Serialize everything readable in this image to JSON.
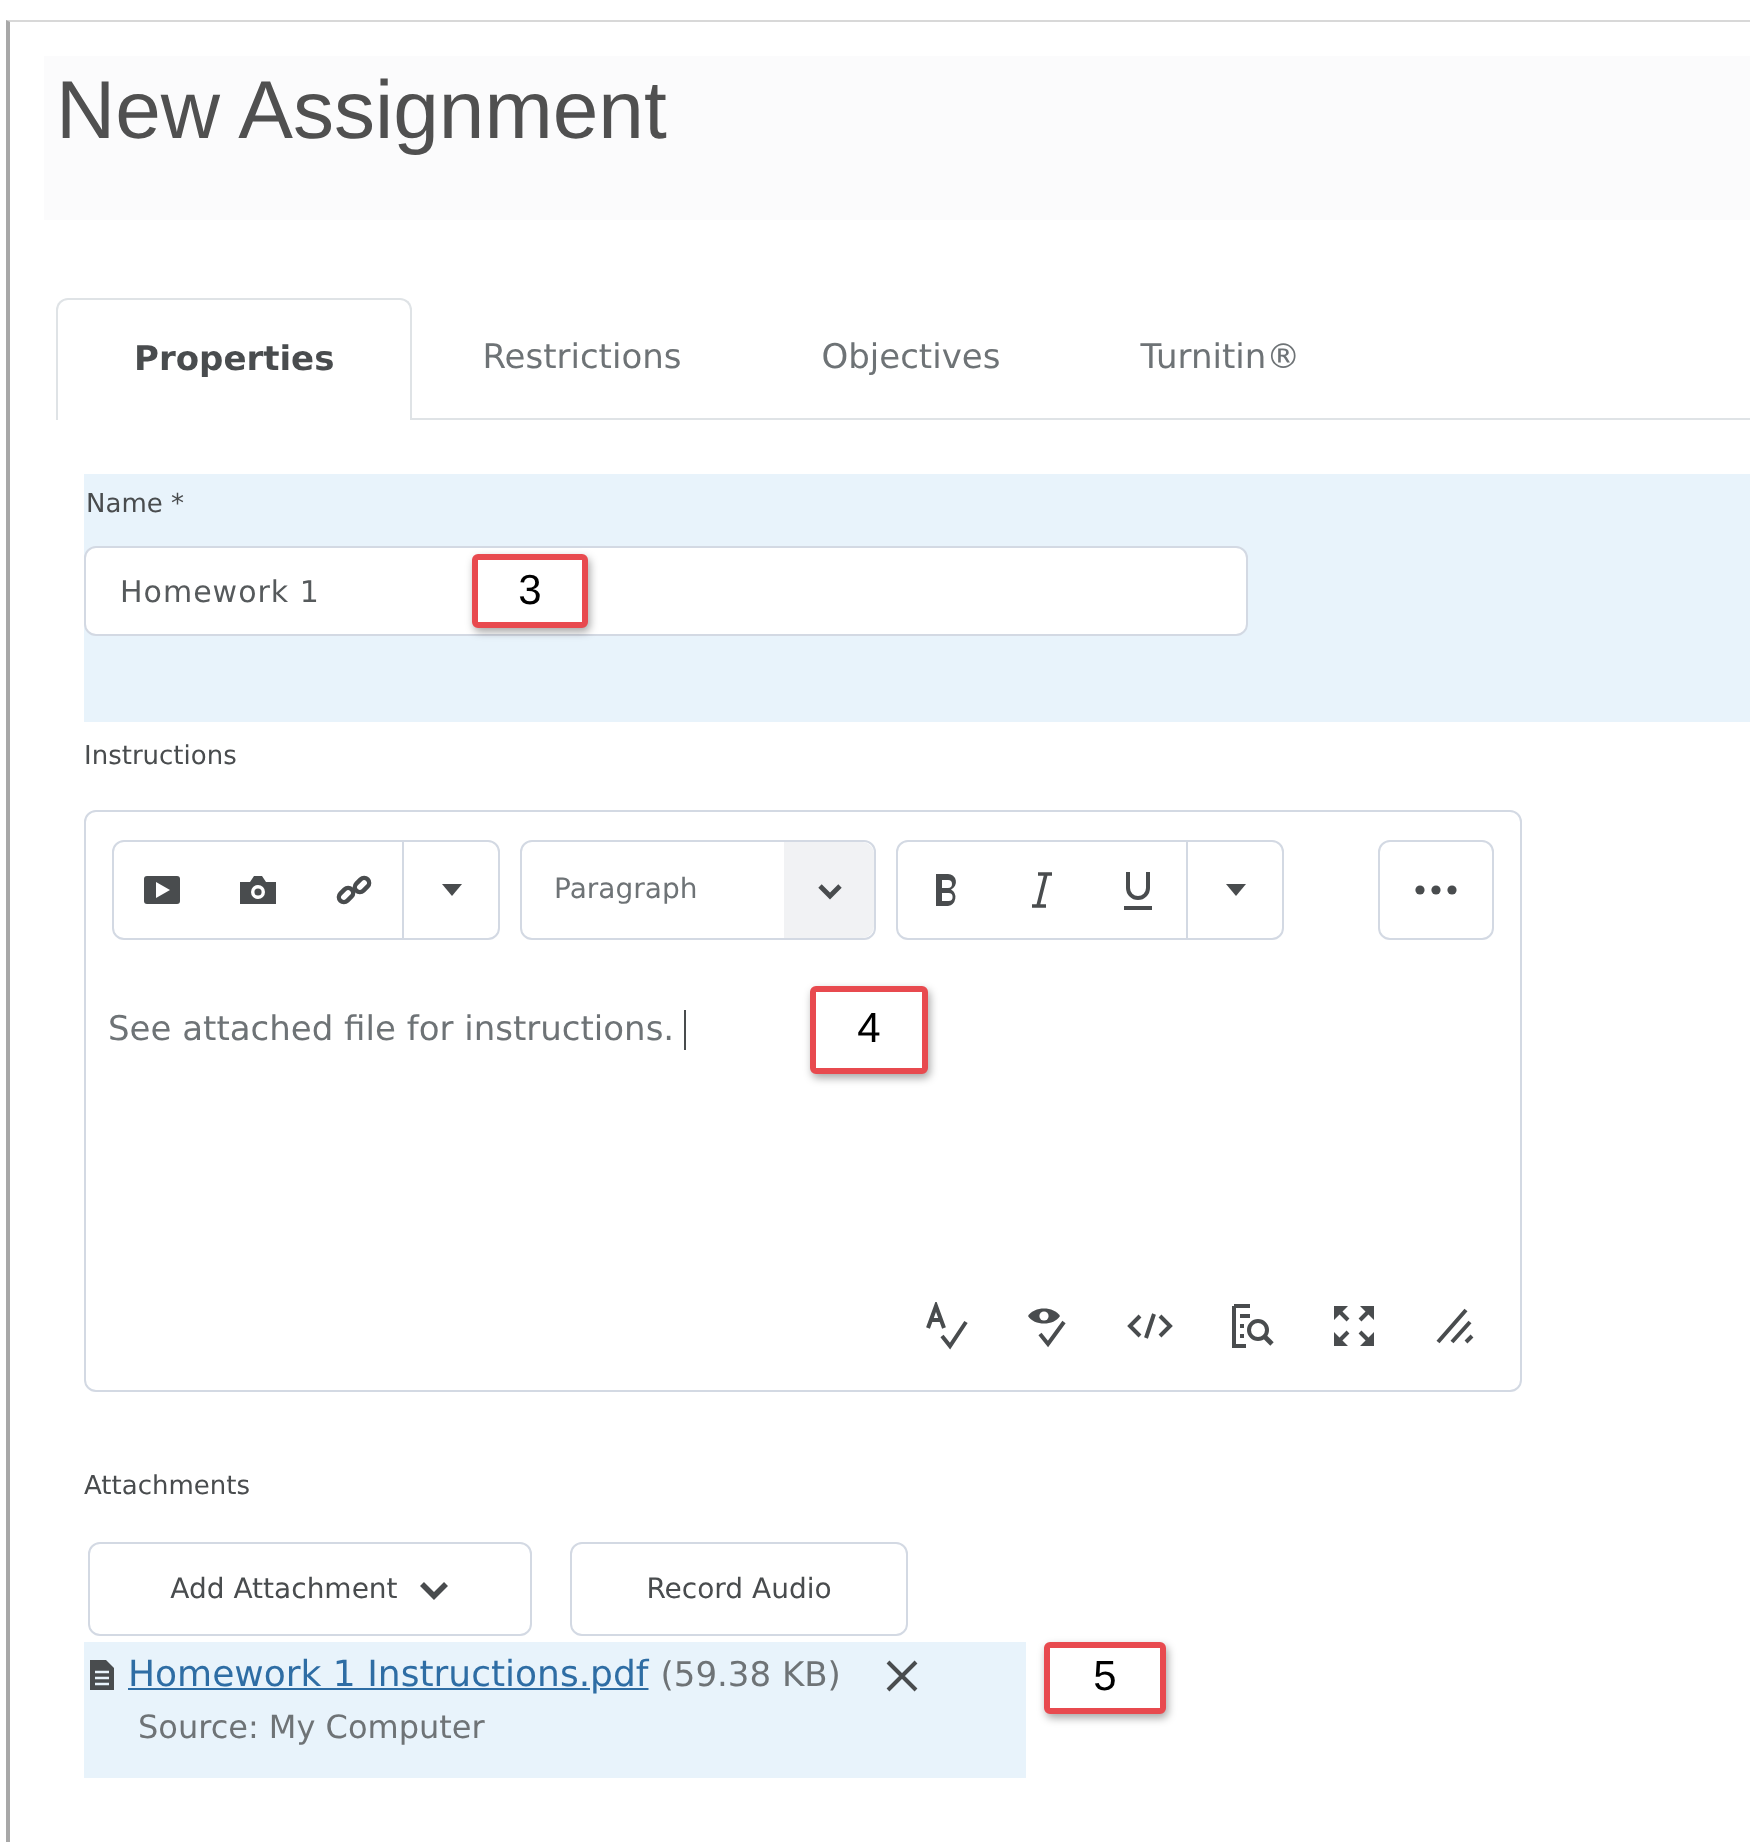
{
  "page": {
    "title": "New Assignment"
  },
  "tabs": [
    {
      "label": "Properties",
      "selected": true
    },
    {
      "label": "Restrictions",
      "selected": false
    },
    {
      "label": "Objectives",
      "selected": false
    },
    {
      "label": "Turnitin®",
      "selected": false
    }
  ],
  "name_field": {
    "label": "Name *",
    "value": "Homework 1",
    "callout": "3"
  },
  "instructions": {
    "label": "Instructions",
    "format": "Paragraph",
    "text": "See attached file for instructions.",
    "callout": "4"
  },
  "attachments": {
    "label": "Attachments",
    "buttons": [
      "Add Attachment",
      "Record Audio"
    ],
    "files": [
      {
        "name": "Homework 1 Instructions.pdf",
        "size": "(59.38 KB)",
        "source": "Source: My Computer",
        "callout": "5"
      }
    ]
  }
}
